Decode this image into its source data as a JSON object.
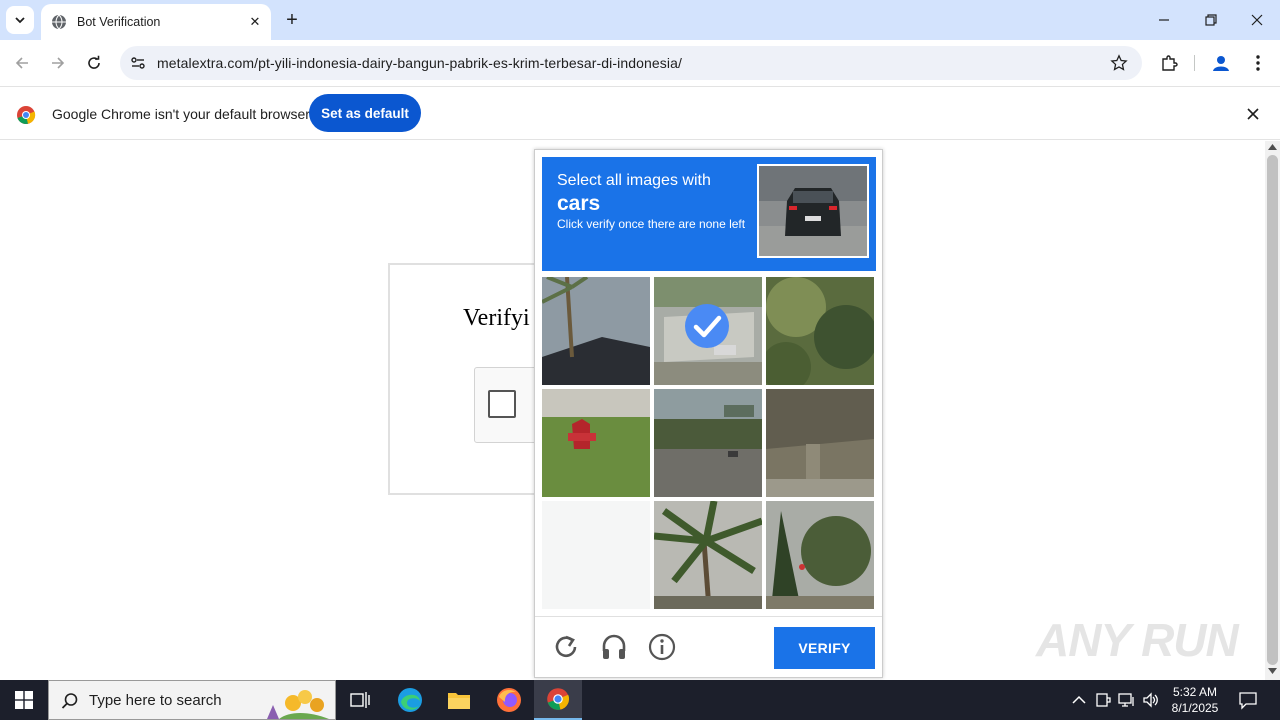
{
  "browser": {
    "tab": {
      "title": "Bot Verification"
    },
    "address": {
      "url": "metalextra.com/pt-yili-indonesia-dairy-bangun-pabrik-es-krim-terbesar-di-indonesia/"
    }
  },
  "infobar": {
    "message": "Google Chrome isn't your default browser",
    "set_default_label": "Set as default"
  },
  "page": {
    "heading": "Verifyi"
  },
  "captcha": {
    "instruction_line1": "Select all images with",
    "target_object": "cars",
    "instruction_line3": "Click verify once there are none left",
    "verify_label": "VERIFY",
    "tiles": [
      {
        "index": 1,
        "selected": false
      },
      {
        "index": 2,
        "selected": true
      },
      {
        "index": 3,
        "selected": false
      },
      {
        "index": 4,
        "selected": false
      },
      {
        "index": 5,
        "selected": false
      },
      {
        "index": 6,
        "selected": false
      },
      {
        "index": 7,
        "selected": false
      },
      {
        "index": 8,
        "selected": false
      },
      {
        "index": 9,
        "selected": false
      }
    ],
    "accent_color": "#1a73e8"
  },
  "watermark": {
    "text": "ANY RUN"
  },
  "taskbar": {
    "search_placeholder": "Type here to search",
    "time": "5:32 AM",
    "date": "8/1/2025"
  }
}
